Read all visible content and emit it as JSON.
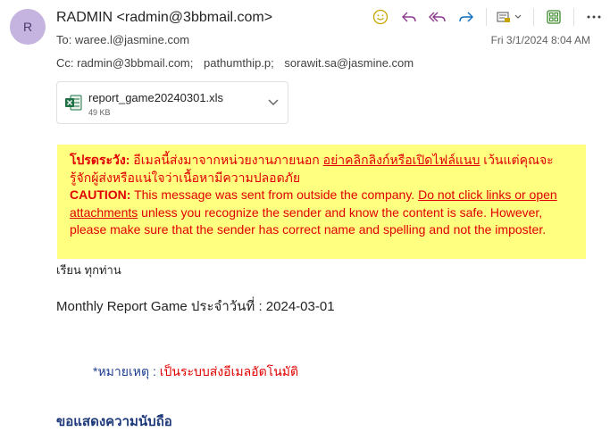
{
  "sender": {
    "initial": "R",
    "display": "RADMIN <radmin@3bbmail.com>"
  },
  "to": {
    "label": "To:",
    "value": "waree.l@jasmine.com"
  },
  "cc": {
    "label": "Cc:",
    "recipients": [
      "radmin@3bbmail.com;",
      "pathumthip.p;",
      "sorawit.sa@jasmine.com"
    ]
  },
  "date": "Fri 3/1/2024 8:04 AM",
  "toolbar": {
    "icons": [
      "emoji-icon",
      "reply-icon",
      "reply-all-icon",
      "forward-icon",
      "apps-icon",
      "more-icon"
    ],
    "accent": "#0f6cbd"
  },
  "attachment": {
    "name": "report_game20240301.xls",
    "size": "49 KB"
  },
  "caution": {
    "th_label": "โปรดระวัง:",
    "th_text1": " อีเมลนี้ส่งมาจากหน่วยงานภายนอก ",
    "th_link": "อย่าคลิกลิงก์หรือเปิดไฟล์แนบ",
    "th_text2": " เว้นแต่คุณจะรู้จักผู้ส่งหรือแน่ใจว่าเนื้อหามีความปลอดภัย",
    "en_label": "CAUTION:",
    "en_text1": " This message was sent from outside the company. ",
    "en_link": "Do not click links or open attachments",
    "en_text2": " unless you recognize the sender and know the content is safe. However, please make sure that the sender has correct name and spelling and not the imposter.",
    "bg_color": "#ffff80",
    "text_color": "#e00000"
  },
  "body": {
    "greeting": "เรียน ทุกท่าน",
    "report_line": "Monthly Report Game ประจำวันที่ : 2024-03-01",
    "remark_label": "*หมายเหตุ : ",
    "remark_text": "เป็นระบบส่งอีเมลอัตโนมัติ",
    "thanks": "ขอแสดงความนับถือ"
  }
}
